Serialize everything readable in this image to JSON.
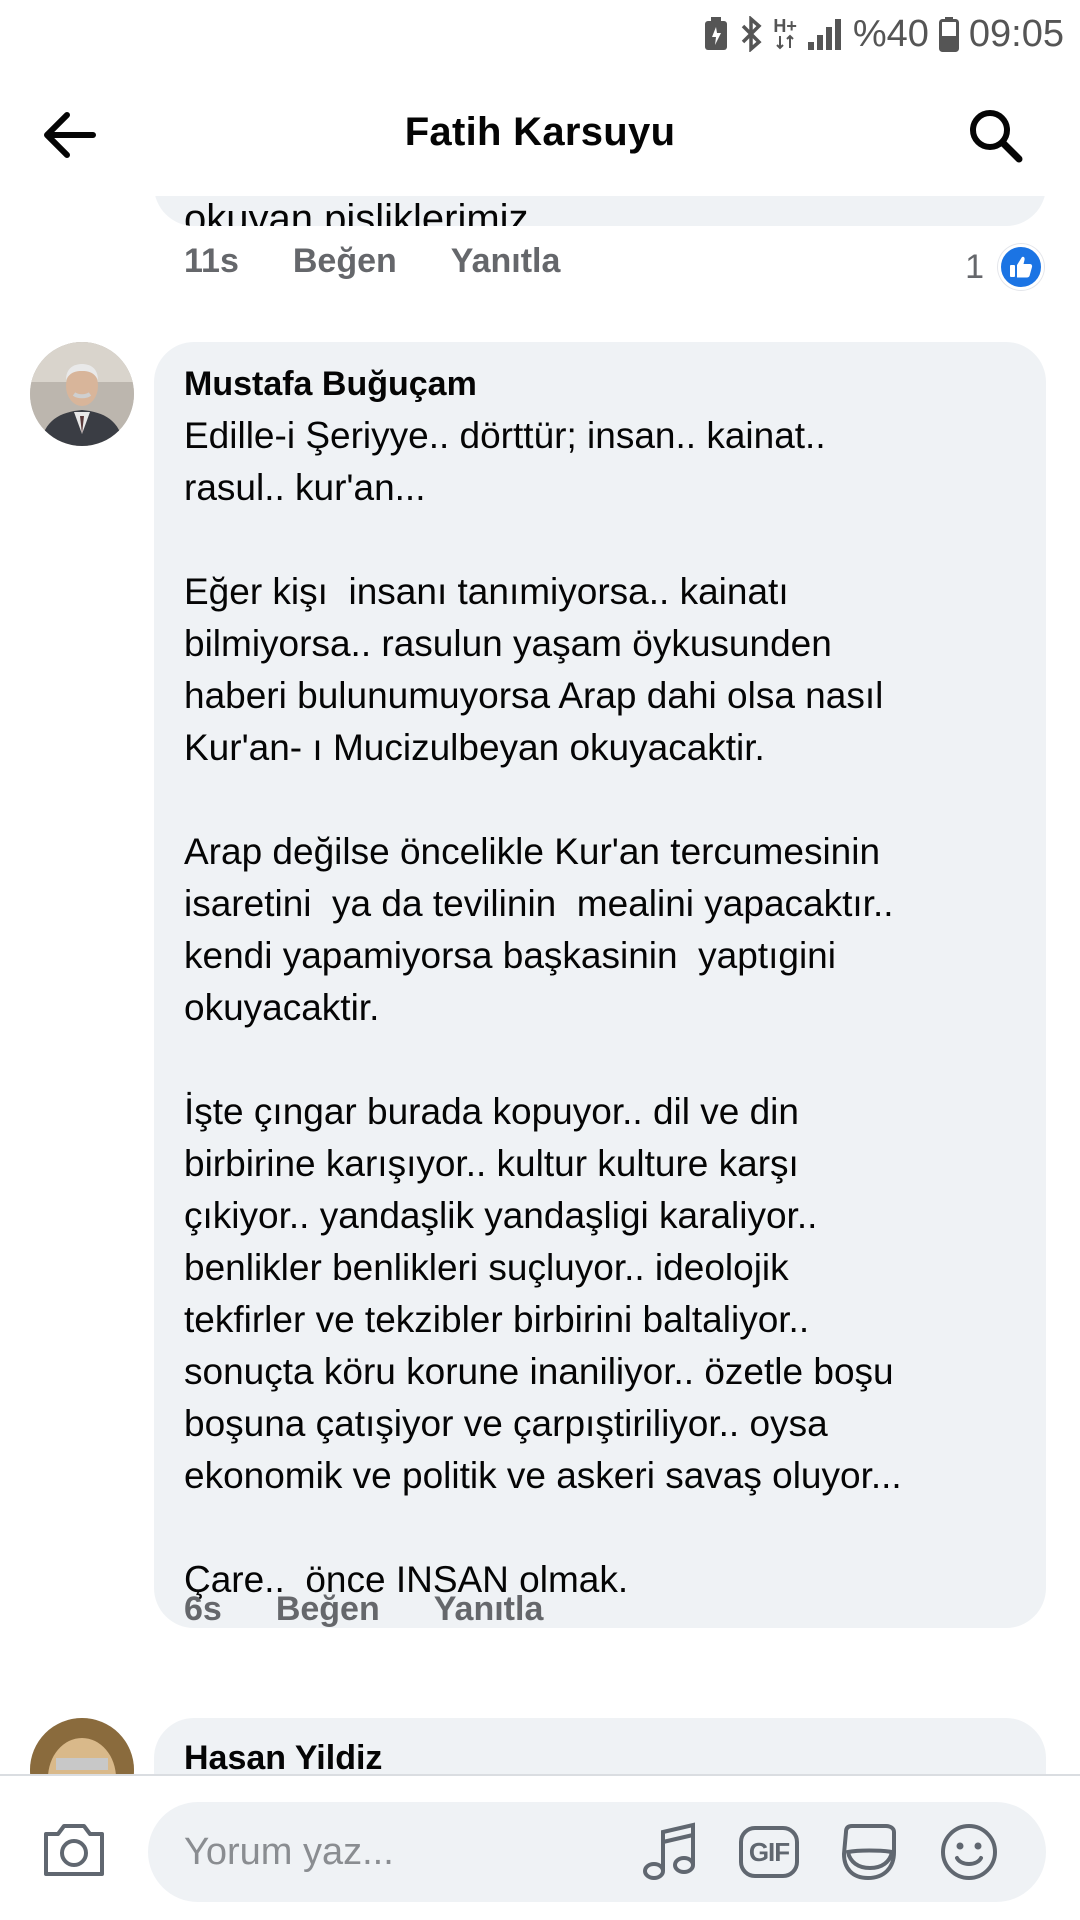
{
  "status_bar": {
    "battery_percent": "%40",
    "time": "09:05",
    "network_type": "H+",
    "icons": [
      "battery-saver-icon",
      "bluetooth-icon",
      "network-type-icon",
      "signal-icon",
      "battery-icon"
    ]
  },
  "header": {
    "title": "Fatih Karsuyu",
    "back_icon": "arrow-left-icon",
    "search_icon": "search-icon"
  },
  "previous_comment": {
    "cut_text": "okuyan pisliklerimiz.",
    "time": "11s",
    "like_label": "Beğen",
    "reply_label": "Yanıtla",
    "reaction_count": "1",
    "reaction_icon": "like-icon"
  },
  "comment": {
    "author": "Mustafa Buğuçam",
    "text": "Edille-i Şeriyye.. dörttür; insan.. kainat..\nrasul.. kur'an...\n\nEğer kişı  insanı tanımiyorsa.. kainatı\nbilmiyorsa.. rasulun yaşam öykusunden\nhaberi bulunumuyorsa Arap dahi olsa nasıl\nKur'an- ı Mucizulbeyan okuyacaktir.\n\nArap değilse öncelikle Kur'an tercumesinin\nisaretini  ya da tevilinin  mealini yapacaktır..\nkendi yapamiyorsa başkasinin  yaptıgini\nokuyacaktir.\n\nİşte çıngar burada kopuyor.. dil ve din\nbirbirine karışıyor.. kultur kulture karşı\nçıkiyor.. yandaşlik yandaşligi karaliyor..\nbenlikler benlikleri suçluyor.. ideolojik\ntekfirler ve tekzibler birbirini baltaliyor..\nsonuçta köru korune inaniliyor.. özetle boşu\nboşuna çatışiyor ve çarpıştiriliyor.. oysa\nekonomik ve politik ve askeri savaş oluyor...\n\nÇare..  önce INSAN olmak.",
    "time": "6s",
    "like_label": "Beğen",
    "reply_label": "Yanıtla"
  },
  "next_comment": {
    "author": "Hasan Yildiz"
  },
  "composer": {
    "placeholder": "Yorum yaz...",
    "camera_icon": "camera-icon",
    "music_icon": "music-note-icon",
    "gif_label": "GIF",
    "sticker_icon": "sticker-icon",
    "emoji_icon": "smiley-icon"
  },
  "colors": {
    "bubble_bg": "#eff2f5",
    "secondary_text": "#65676b",
    "like_blue": "#1b74e4"
  }
}
